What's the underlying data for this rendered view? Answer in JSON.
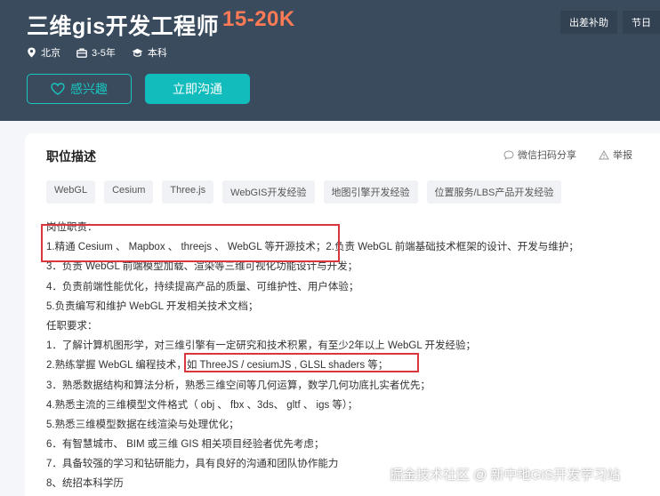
{
  "header": {
    "title": "三维gis开发工程师",
    "salary": "15-20K",
    "benefits": [
      "出差补助",
      "节日"
    ],
    "meta": [
      {
        "icon": "location-icon",
        "text": "北京"
      },
      {
        "icon": "briefcase-icon",
        "text": "3-5年"
      },
      {
        "icon": "graduation-cap-icon",
        "text": "本科"
      }
    ],
    "interest_label": "感兴趣",
    "chat_label": "立即沟通"
  },
  "card": {
    "title": "职位描述",
    "share_label": "微信扫码分享",
    "report_label": "举报",
    "tags": [
      "WebGL",
      "Cesium",
      "Three.js",
      "WebGIS开发经验",
      "地图引擎开发经验",
      "位置服务/LBS产品开发经验"
    ],
    "lines": [
      "岗位职责：",
      "1.精通 Cesium 、 Mapbox 、 threejs 、 WebGL 等开源技术；2.负责 WebGL 前端基础技术框架的设计、开发与维护；",
      "3．负责 WebGL 前端模型加载、渲染等三维可视化功能设计与开发；",
      "4．负责前端性能优化，持续提高产品的质量、可维护性、用户体验；",
      "5.负责编写和维护 WebGL 开发相关技术文档；",
      "任职要求：",
      "1．了解计算机图形学，对三维引擎有一定研究和技术积累，有至少2年以上 WebGL 开发经验；",
      "2.熟练掌握 WebGL 编程技术，如 ThreeJS / cesiumJS , GLSL shaders 等；",
      "3．熟悉数据结构和算法分析，熟悉三维空间等几何运算，数学几何功底扎实者优先；",
      "4.熟悉主流的三维模型文件格式（ obj 、 fbx 、3ds、 gltf 、 igs 等）；",
      "5.熟悉三维模型数据在线渲染与处理优化；",
      "6．有智慧城市、 BIM 或三维 GIS 相关项目经验者优先考虑；",
      "7．具备较强的学习和钻研能力，具有良好的沟通和团队协作能力",
      "8、统招本科学历"
    ]
  },
  "watermark": "掘金技术社区 @ 新中地GIS开发学习站",
  "colors": {
    "header_bg": "#3a4b5d",
    "accent": "#12bcbc",
    "salary": "#ff7a55",
    "annotation_box": "#d9363e"
  }
}
